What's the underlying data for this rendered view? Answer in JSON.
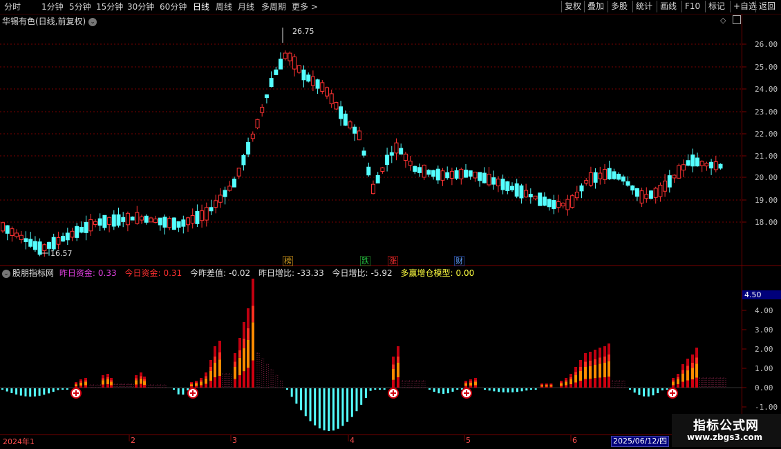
{
  "toolbar": {
    "left": [
      "分时",
      "1分钟",
      "5分钟",
      "15分钟",
      "30分钟",
      "60分钟",
      "日线",
      "周线",
      "月线",
      "多周期",
      "更多 >"
    ],
    "active": "日线",
    "right": [
      "复权",
      "叠加",
      "多股",
      "统计",
      "画线",
      "F10",
      "标记",
      "+自选",
      "返回"
    ]
  },
  "main_title": "华锡有色(日线,前复权)",
  "price_axis": [
    "26.00",
    "25.00",
    "24.00",
    "23.00",
    "22.00",
    "21.00",
    "20.00",
    "19.00",
    "18.00"
  ],
  "high_label": "26.75",
  "low_label": "16.57",
  "tags": [
    {
      "text": "榜",
      "color": "#d4a020"
    },
    {
      "text": "跌",
      "color": "#22c040"
    },
    {
      "text": "涨",
      "color": "#ff3030"
    },
    {
      "text": "财",
      "color": "#60a0ff"
    }
  ],
  "indicator": {
    "name": "股朋指标网",
    "items": [
      {
        "label": "昨日资金:",
        "value": "0.33",
        "color": "#e040e0"
      },
      {
        "label": "今日资金:",
        "value": "0.31",
        "color": "#ff3030"
      },
      {
        "label": "今昨差值:",
        "value": "-0.02",
        "color": "#e0e0e0"
      },
      {
        "label": "昨日增比:",
        "value": "-33.33",
        "color": "#e0e0e0"
      },
      {
        "label": "今日增比:",
        "value": "-5.92",
        "color": "#e0e0e0"
      },
      {
        "label": "多赢增仓模型:",
        "value": "0.00",
        "color": "#ffff40"
      }
    ],
    "axis": [
      "4.00",
      "3.00",
      "2.00",
      "1.00",
      "0.00",
      "-1.00"
    ],
    "current_value": "4.50"
  },
  "time_axis": {
    "year_label": "2024年1",
    "months": [
      "2",
      "3",
      "4",
      "5",
      "6"
    ],
    "cursor_date": "2025/06/12/四"
  },
  "watermark": {
    "title": "指标公式网",
    "url": "www.zbgs3.com"
  },
  "colors": {
    "up": "#ff3232",
    "down": "#54ffff",
    "grid": "#7a0000"
  }
}
